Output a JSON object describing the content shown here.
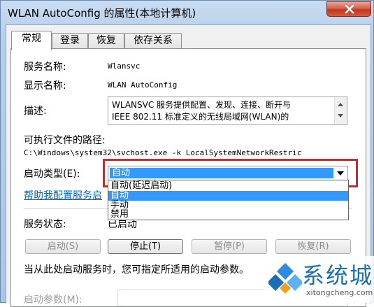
{
  "window": {
    "title": "WLAN AutoConfig 的属性(本地计算机)"
  },
  "tabs": [
    {
      "label": "常规"
    },
    {
      "label": "登录"
    },
    {
      "label": "恢复"
    },
    {
      "label": "依存关系"
    }
  ],
  "general": {
    "service_name_label": "服务名称:",
    "service_name_value": "Wlansvc",
    "display_name_label": "显示名称:",
    "display_name_value": "WLAN AutoConfig",
    "description_label": "描述:",
    "description_lines": [
      "WLANSVC 服务提供配置、发现、连接、断开与",
      "IEEE 802.11 标准定义的无线局域网(WLAN)的"
    ],
    "exe_path_label": "可执行文件的路径:",
    "exe_path_value": "C:\\Windows\\system32\\svchost.exe -k LocalSystemNetworkRestric",
    "startup_type_label": "启动类型(E):",
    "startup_type_value": "自动",
    "startup_options": [
      "自动(延迟启动)",
      "自动",
      "手动",
      "禁用"
    ],
    "help_link": "帮助我配置服务启",
    "service_status_label": "服务状态:",
    "service_status_value": "已启动",
    "buttons": {
      "start": "启动(S)",
      "stop": "停止(T)",
      "pause": "暂停(P)",
      "resume": "恢复(R)"
    },
    "hint_text": "当从此处启动服务时，您可指定所适用的启动参数。",
    "start_params_label": "启动参数(M):"
  },
  "watermark": {
    "brand": "系统城",
    "url": "xitongcheng.com"
  },
  "colors": {
    "selection": "#3399ff",
    "highlight_border": "#e02020",
    "link": "#0066cc",
    "close_button": "#c2351f"
  }
}
